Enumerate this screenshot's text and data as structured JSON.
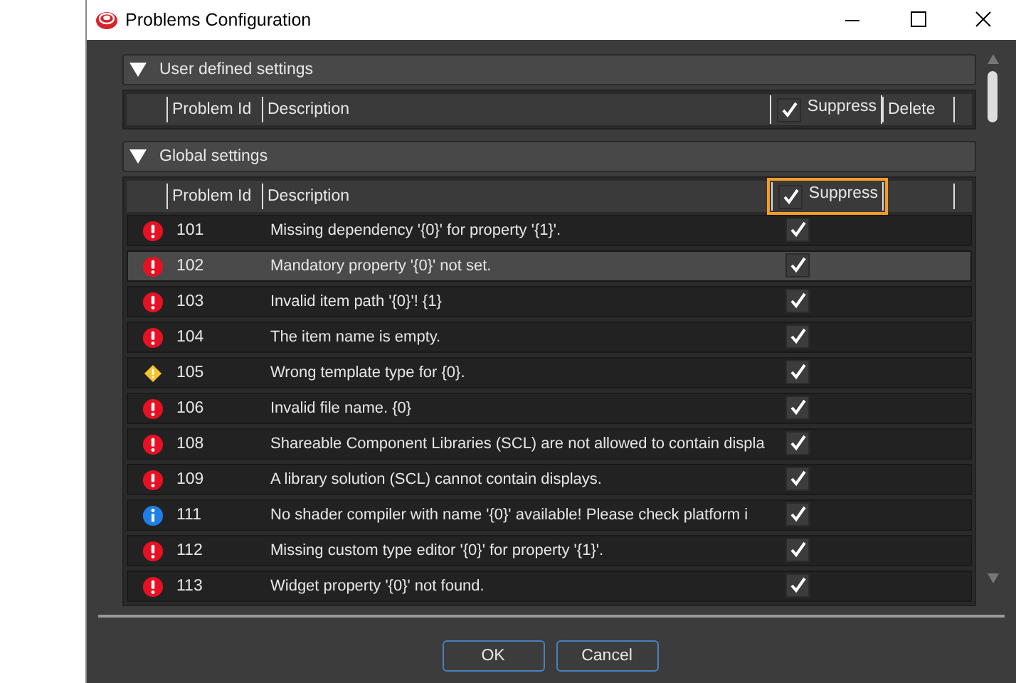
{
  "window": {
    "title": "Problems Configuration"
  },
  "sections": [
    {
      "title": "User defined settings",
      "expanded": true,
      "columns": {
        "id": "Problem Id",
        "description": "Description",
        "suppress": "Suppress",
        "suppress_all": true,
        "delete": "Delete",
        "focused": false
      }
    },
    {
      "title": "Global settings",
      "expanded": true,
      "columns": {
        "id": "Problem Id",
        "description": "Description",
        "suppress": "Suppress",
        "suppress_all": true,
        "focused": true
      },
      "rows": [
        {
          "kind": "error",
          "id": "101",
          "description": "Missing dependency '{0}' for property '{1}'.",
          "suppressed": true,
          "selected": false
        },
        {
          "kind": "error",
          "id": "102",
          "description": "Mandatory property '{0}' not set.",
          "suppressed": true,
          "selected": true
        },
        {
          "kind": "error",
          "id": "103",
          "description": "Invalid item path '{0}'! {1}",
          "suppressed": true,
          "selected": false
        },
        {
          "kind": "error",
          "id": "104",
          "description": "The item name is empty.",
          "suppressed": true,
          "selected": false
        },
        {
          "kind": "warning",
          "id": "105",
          "description": "Wrong template type for {0}.",
          "suppressed": true,
          "selected": false
        },
        {
          "kind": "error",
          "id": "106",
          "description": "Invalid file name. {0}",
          "suppressed": true,
          "selected": false
        },
        {
          "kind": "error",
          "id": "108",
          "description": "Shareable Component Libraries (SCL) are not allowed to contain displa",
          "suppressed": true,
          "selected": false
        },
        {
          "kind": "error",
          "id": "109",
          "description": "A library solution (SCL) cannot contain displays.",
          "suppressed": true,
          "selected": false
        },
        {
          "kind": "info",
          "id": "111",
          "description": "No shader compiler with name '{0}' available! Please check platform i",
          "suppressed": true,
          "selected": false
        },
        {
          "kind": "error",
          "id": "112",
          "description": "Missing custom type editor '{0}' for property '{1}'.",
          "suppressed": true,
          "selected": false
        },
        {
          "kind": "error",
          "id": "113",
          "description": "Widget property '{0}' not found.",
          "suppressed": true,
          "selected": false
        }
      ]
    }
  ],
  "buttons": [
    {
      "label": "OK"
    },
    {
      "label": "Cancel"
    }
  ]
}
